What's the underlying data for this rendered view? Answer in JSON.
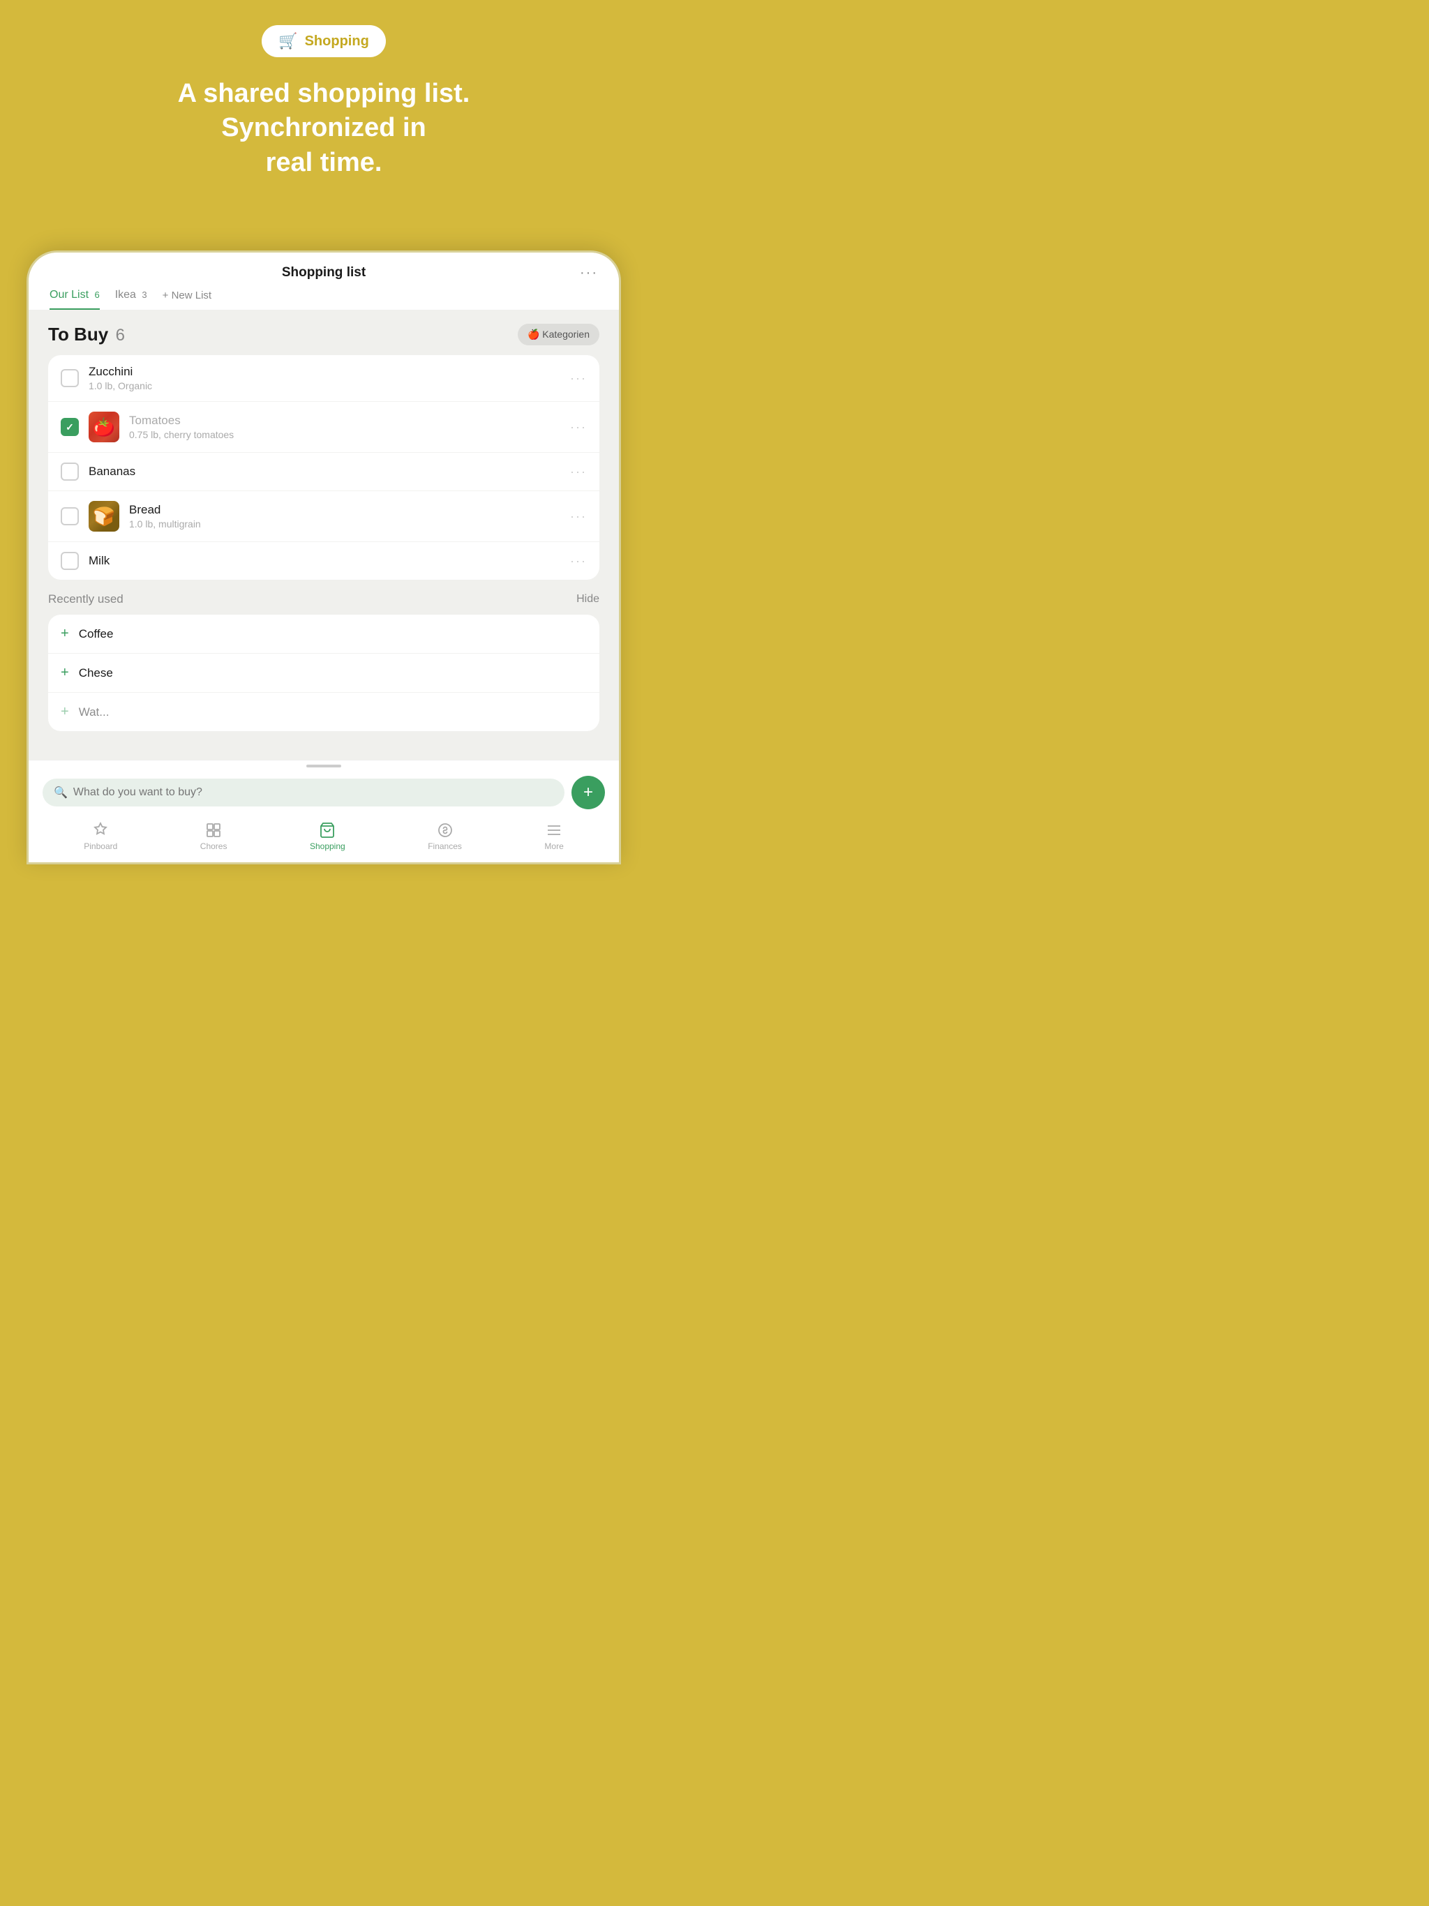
{
  "header": {
    "badge_icon": "🛒",
    "badge_label": "Shopping",
    "hero_text": "A shared shopping list.\nSynchronized in\nreal time."
  },
  "app": {
    "title": "Shopping list",
    "more_dots": "···"
  },
  "tabs": [
    {
      "label": "Our List",
      "badge": "6",
      "active": true
    },
    {
      "label": "Ikea",
      "badge": "3",
      "active": false
    },
    {
      "label": "+ New List",
      "badge": "",
      "active": false
    }
  ],
  "to_buy": {
    "title": "To Buy",
    "count": "6",
    "kategorien_label": "🍎 Kategorien",
    "items": [
      {
        "name": "Zucchini",
        "detail": "1.0 lb, Organic",
        "checked": false,
        "has_thumb": false
      },
      {
        "name": "Tomatoes",
        "detail": "0.75 lb, cherry tomatoes",
        "checked": true,
        "has_thumb": "tomatoes"
      },
      {
        "name": "Bananas",
        "detail": "",
        "checked": false,
        "has_thumb": false
      },
      {
        "name": "Bread",
        "detail": "1.0 lb, multigrain",
        "checked": false,
        "has_thumb": "bread"
      },
      {
        "name": "Milk",
        "detail": "",
        "checked": false,
        "has_thumb": false
      }
    ]
  },
  "recently_used": {
    "title": "Recently used",
    "hide_label": "Hide",
    "items": [
      {
        "name": "Coffee"
      },
      {
        "name": "Chese"
      },
      {
        "name": "Wat..."
      }
    ]
  },
  "search": {
    "placeholder": "What do you want to buy?"
  },
  "bottom_nav": [
    {
      "icon": "pinboard",
      "label": "Pinboard",
      "active": false
    },
    {
      "icon": "chores",
      "label": "Chores",
      "active": false
    },
    {
      "icon": "shopping",
      "label": "Shopping",
      "active": true
    },
    {
      "icon": "finances",
      "label": "Finances",
      "active": false
    },
    {
      "icon": "more",
      "label": "More",
      "active": false
    }
  ],
  "colors": {
    "brand_yellow": "#D4B93C",
    "brand_green": "#3a9e5f",
    "bg_light": "#f0f0ed",
    "white": "#ffffff"
  }
}
